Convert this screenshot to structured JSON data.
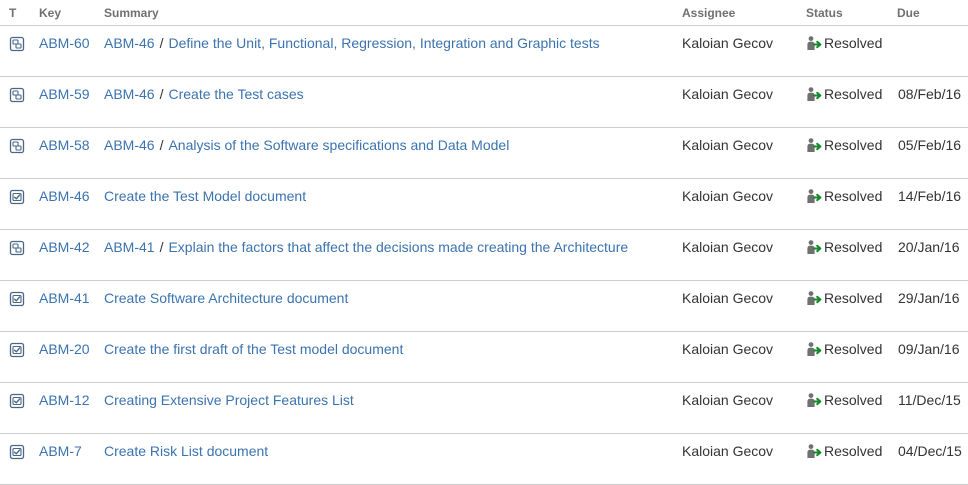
{
  "columns": {
    "type": "T",
    "key": "Key",
    "summary": "Summary",
    "assignee": "Assignee",
    "status": "Status",
    "due": "Due"
  },
  "colors": {
    "link": "#3b73af",
    "resolved_arrow": "#14892c",
    "person_icon": "#707070",
    "subtask_icon": "#4a6785",
    "task_icon": "#4a6785"
  },
  "rows": [
    {
      "type_icon": "subtask-icon",
      "key": "ABM-60",
      "parent": "ABM-46",
      "separator": "/",
      "summary": "Define the Unit, Functional, Regression, Integration and Graphic tests",
      "assignee": "Kaloian Gecov",
      "status": "Resolved",
      "due": ""
    },
    {
      "type_icon": "subtask-icon",
      "key": "ABM-59",
      "parent": "ABM-46",
      "separator": "/",
      "summary": "Create the Test cases",
      "assignee": "Kaloian Gecov",
      "status": "Resolved",
      "due": "08/Feb/16"
    },
    {
      "type_icon": "subtask-icon",
      "key": "ABM-58",
      "parent": "ABM-46",
      "separator": "/",
      "summary": "Analysis of the Software specifications and Data Model",
      "assignee": "Kaloian Gecov",
      "status": "Resolved",
      "due": "05/Feb/16"
    },
    {
      "type_icon": "task-icon",
      "key": "ABM-46",
      "parent": "",
      "separator": "",
      "summary": "Create the Test Model document",
      "assignee": "Kaloian Gecov",
      "status": "Resolved",
      "due": "14/Feb/16"
    },
    {
      "type_icon": "subtask-icon",
      "key": "ABM-42",
      "parent": "ABM-41",
      "separator": "/",
      "summary": "Explain the factors that affect the decisions made creating the Architecture",
      "assignee": "Kaloian Gecov",
      "status": "Resolved",
      "due": "20/Jan/16"
    },
    {
      "type_icon": "task-icon",
      "key": "ABM-41",
      "parent": "",
      "separator": "",
      "summary": "Create Software Architecture document",
      "assignee": "Kaloian Gecov",
      "status": "Resolved",
      "due": "29/Jan/16"
    },
    {
      "type_icon": "task-icon",
      "key": "ABM-20",
      "parent": "",
      "separator": "",
      "summary": "Create the first draft of the Test model document",
      "assignee": "Kaloian Gecov",
      "status": "Resolved",
      "due": "09/Jan/16"
    },
    {
      "type_icon": "task-icon",
      "key": "ABM-12",
      "parent": "",
      "separator": "",
      "summary": "Creating Extensive Project Features List",
      "assignee": "Kaloian Gecov",
      "status": "Resolved",
      "due": "11/Dec/15"
    },
    {
      "type_icon": "task-icon",
      "key": "ABM-7",
      "parent": "",
      "separator": "",
      "summary": "Create Risk List document",
      "assignee": "Kaloian Gecov",
      "status": "Resolved",
      "due": "04/Dec/15"
    }
  ]
}
